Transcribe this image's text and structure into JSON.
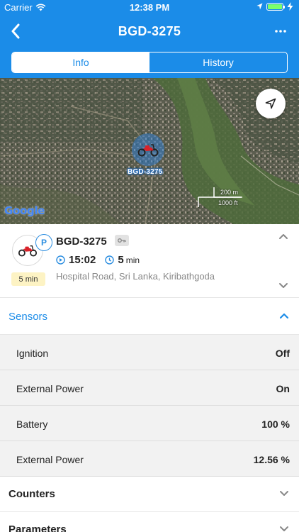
{
  "status_bar": {
    "carrier": "Carrier",
    "time": "12:38 PM",
    "battery_level": 1.0
  },
  "nav": {
    "title": "BGD-3275"
  },
  "tabs": [
    {
      "label": "Info",
      "active": true
    },
    {
      "label": "History",
      "active": false
    }
  ],
  "map": {
    "marker_label": "BGD-3275",
    "google_logo": "Google",
    "scale_metric": "200 m",
    "scale_imperial": "1000 ft"
  },
  "device": {
    "name": "BGD-3275",
    "status_icon": "parking-icon",
    "status_letter": "P",
    "stop_badge": "5 min",
    "time": "15:02",
    "duration_value": "5",
    "duration_unit": "min",
    "address": "Hospital Road, Sri Lanka, Kiribathgoda"
  },
  "sensors": {
    "title": "Sensors",
    "expanded": true,
    "rows": [
      {
        "name": "Ignition",
        "value": "Off"
      },
      {
        "name": "External Power",
        "value": "On"
      },
      {
        "name": "Battery",
        "value": "100 %"
      },
      {
        "name": "External Power",
        "value": "12.56 %"
      }
    ]
  },
  "counters": {
    "title": "Counters",
    "expanded": false
  },
  "parameters": {
    "title": "Parameters",
    "expanded": false
  },
  "colors": {
    "accent": "#1b8ce8",
    "badge_bg": "#fdf3c4",
    "sensor_bg": "#f2f2f2"
  }
}
